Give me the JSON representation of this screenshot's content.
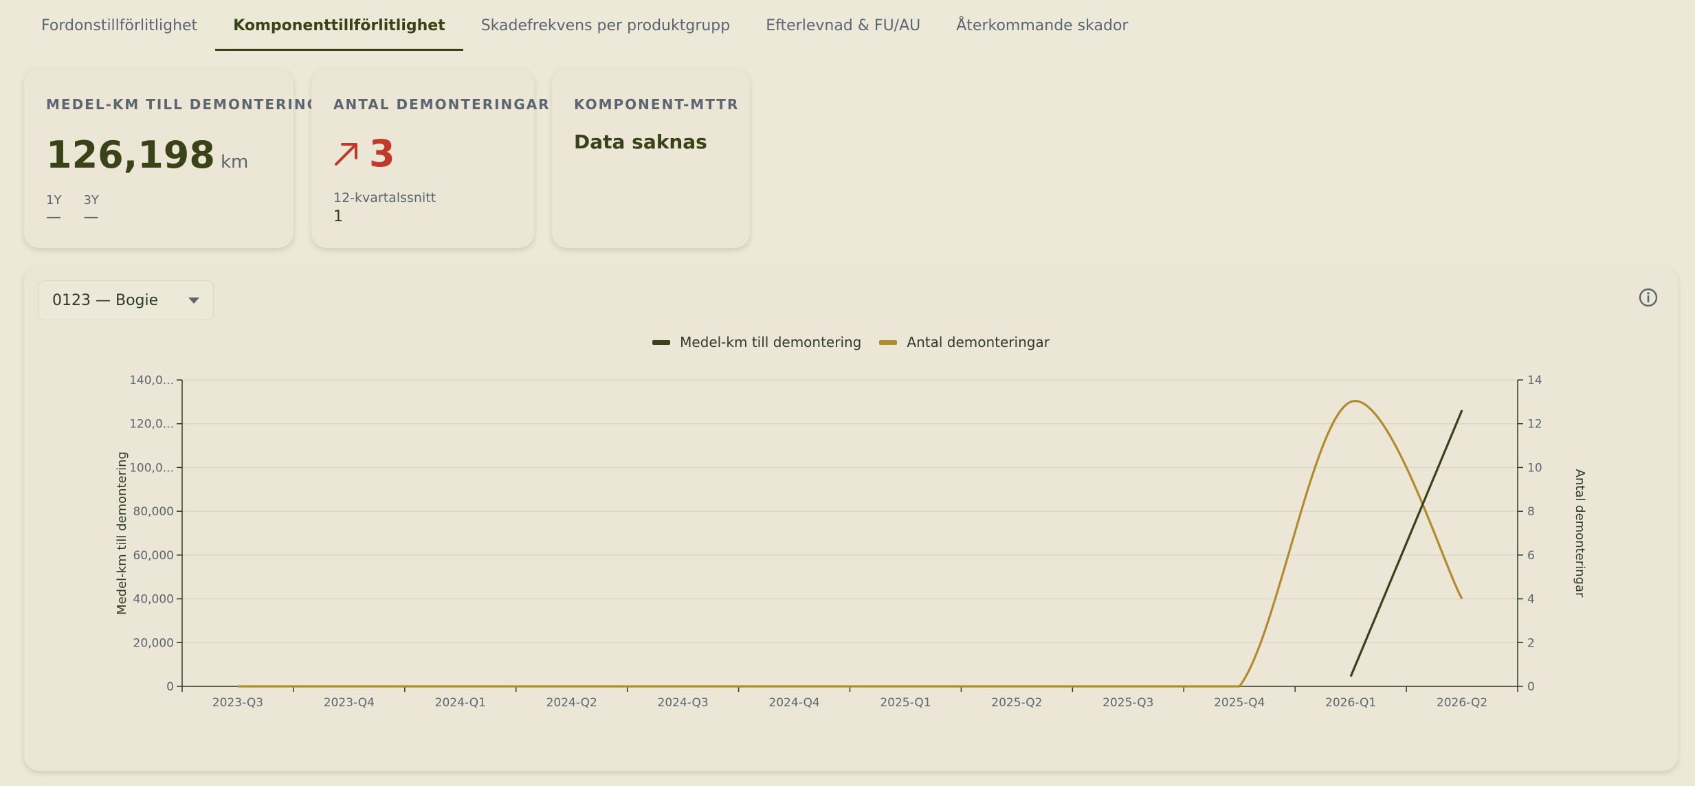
{
  "tabs": [
    {
      "label": "Fordonstillförlitlighet",
      "active": false
    },
    {
      "label": "Komponenttillförlitlighet",
      "active": true
    },
    {
      "label": "Skadefrekvens per produktgrupp",
      "active": false
    },
    {
      "label": "Efterlevnad & FU/AU",
      "active": false
    },
    {
      "label": "Återkommande skador",
      "active": false
    }
  ],
  "kpi_km": {
    "title": "Medel-km till demontering",
    "value": "126,198",
    "unit": "km",
    "sub": [
      {
        "label": "1Y",
        "value": "—"
      },
      {
        "label": "3Y",
        "value": "—"
      }
    ]
  },
  "kpi_count": {
    "title": "Antal demonteringar",
    "trend": "up",
    "value": "3",
    "avg_label": "12-kvartalssnitt",
    "avg_value": "1"
  },
  "kpi_mttr": {
    "title": "Komponent-MTTR",
    "value": "Data saknas"
  },
  "component_select": {
    "value": "0123 — Bogie"
  },
  "colors": {
    "km_series": "#3a4217",
    "count_series": "#b08c2e",
    "down_trend": "#c0392b"
  },
  "chart_data": {
    "type": "line",
    "categories": [
      "2023-Q3",
      "2023-Q4",
      "2024-Q1",
      "2024-Q2",
      "2024-Q3",
      "2024-Q4",
      "2025-Q1",
      "2025-Q2",
      "2025-Q3",
      "2025-Q4",
      "2026-Q1",
      "2026-Q2"
    ],
    "series": [
      {
        "name": "Medel-km till demontering",
        "axis": "left",
        "values": [
          null,
          null,
          null,
          null,
          null,
          null,
          null,
          null,
          null,
          null,
          4500,
          126198
        ]
      },
      {
        "name": "Antal demonteringar",
        "axis": "right",
        "values": [
          0,
          0,
          0,
          0,
          0,
          0,
          0,
          0,
          0,
          0,
          13,
          4
        ]
      }
    ],
    "y_left": {
      "label": "Medel-km till demontering",
      "min": 0,
      "max": 140000,
      "ticks": [
        "0",
        "20,000",
        "40,000",
        "60,000",
        "80,000",
        "100,0...",
        "120,0...",
        "140,0..."
      ]
    },
    "y_right": {
      "label": "Antal demonteringar",
      "min": 0,
      "max": 14,
      "ticks": [
        "0",
        "2",
        "4",
        "6",
        "8",
        "10",
        "12",
        "14"
      ]
    },
    "grid": true,
    "legend": "top-center"
  }
}
